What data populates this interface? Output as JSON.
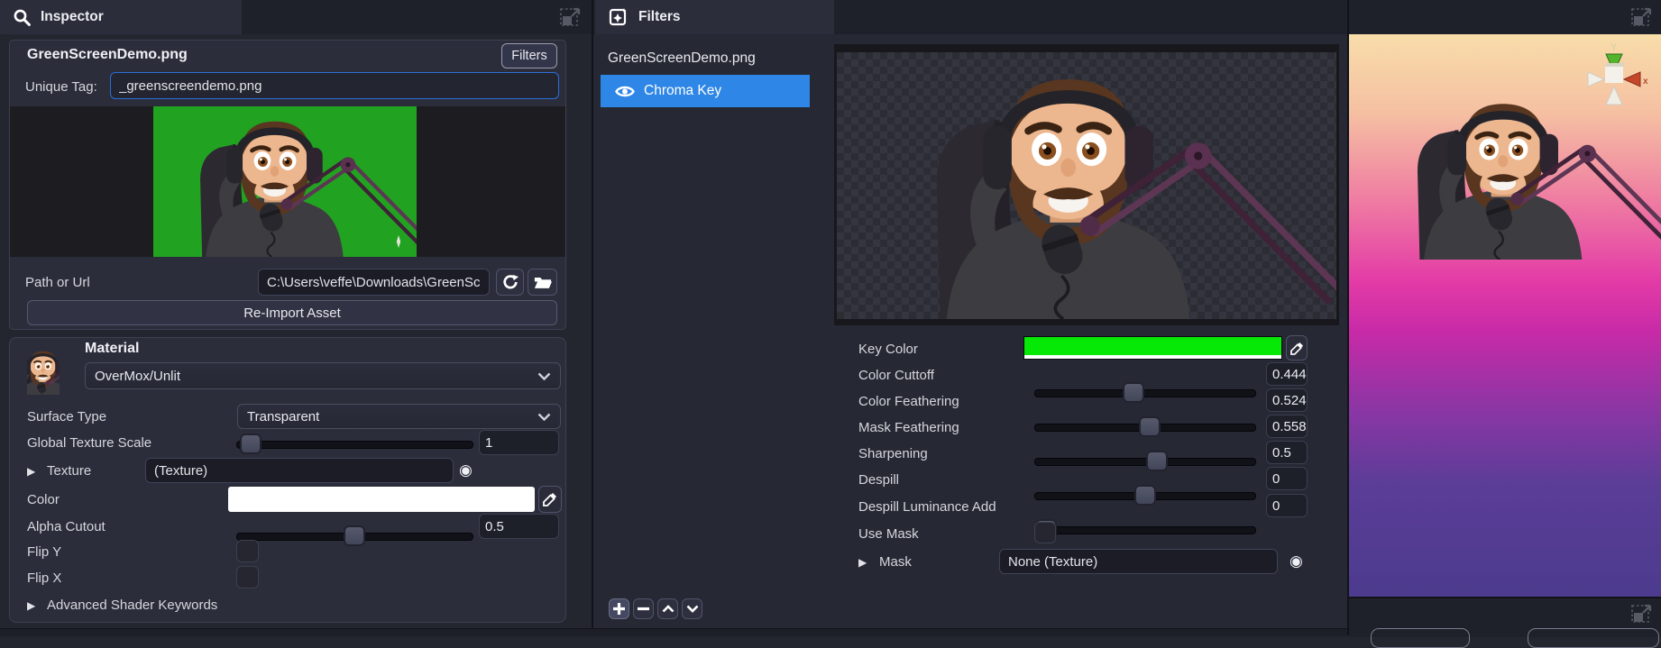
{
  "colors": {
    "accent_blue": "#2e86e6",
    "key_green": "#06e806",
    "preview_green": "#21a321",
    "focus_border": "#2b6fd8",
    "color_swatch": "#ffffff"
  },
  "icons": {
    "foldout": "▶",
    "target": "◉"
  },
  "inspector": {
    "tab_label": "Inspector",
    "title": "GreenScreenDemo.png",
    "filters_button": "Filters",
    "unique_tag": {
      "label": "Unique Tag:",
      "value": "_greenscreendemo.png"
    },
    "path": {
      "label": "Path or Url",
      "value": "C:\\Users\\veffe\\Downloads\\GreenScr"
    },
    "reimport_button": "Re-Import Asset",
    "material": {
      "header": "Material",
      "shader": "OverMox/Unlit",
      "surface_type": {
        "label": "Surface Type",
        "value": "Transparent"
      },
      "global_texture_scale": {
        "label": "Global Texture Scale",
        "value": "1"
      },
      "texture": {
        "label": "Texture",
        "value": "(Texture)"
      },
      "color": {
        "label": "Color"
      },
      "alpha_cutout": {
        "label": "Alpha Cutout",
        "value": "0.5"
      },
      "flip_y": {
        "label": "Flip Y",
        "checked": false
      },
      "flip_x": {
        "label": "Flip X",
        "checked": false
      },
      "advanced": "Advanced Shader Keywords"
    }
  },
  "filters": {
    "tab_label": "Filters",
    "source_name": "GreenScreenDemo.png",
    "selected_filter": "Chroma Key",
    "params": {
      "key_color": {
        "label": "Key Color"
      },
      "color_cuttoff": {
        "label": "Color Cuttoff",
        "value": "0.4446"
      },
      "color_feathering": {
        "label": "Color Feathering",
        "value": "0.5248"
      },
      "mask_feathering": {
        "label": "Mask Feathering",
        "value": "0.5583"
      },
      "sharpening": {
        "label": "Sharpening",
        "value": "0.5"
      },
      "despill": {
        "label": "Despill",
        "value": "0"
      },
      "despill_luminance_add": {
        "label": "Despill Luminance Add",
        "value": "0"
      },
      "use_mask": {
        "label": "Use Mask",
        "checked": false
      },
      "mask": {
        "label": "Mask",
        "value": "None (Texture)"
      }
    }
  },
  "scene": {
    "gizmo": {
      "y_label": "Y",
      "x_label": "x"
    }
  }
}
